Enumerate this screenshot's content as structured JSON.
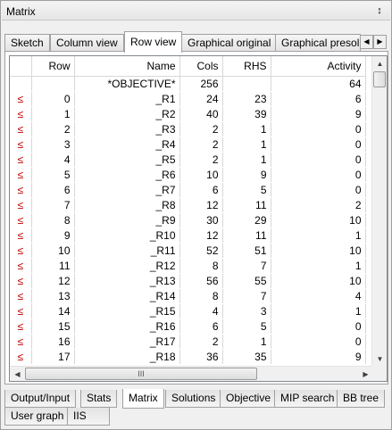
{
  "window": {
    "title": "Matrix",
    "pin_glyph": "↕"
  },
  "top_tabs": [
    "Sketch",
    "Column view",
    "Row view",
    "Graphical original",
    "Graphical presol"
  ],
  "active_top_tab": "Row view",
  "columns": [
    "",
    "Row",
    "Name",
    "Cols",
    "RHS",
    "Activity"
  ],
  "objective_row": {
    "name": "*OBJECTIVE*",
    "cols": "256",
    "rhs": "",
    "activity": "64"
  },
  "constraint_marker": "≤",
  "rows": [
    {
      "row": "0",
      "name": "_R1",
      "cols": "24",
      "rhs": "23",
      "activity": "6"
    },
    {
      "row": "1",
      "name": "_R2",
      "cols": "40",
      "rhs": "39",
      "activity": "9"
    },
    {
      "row": "2",
      "name": "_R3",
      "cols": "2",
      "rhs": "1",
      "activity": "0"
    },
    {
      "row": "3",
      "name": "_R4",
      "cols": "2",
      "rhs": "1",
      "activity": "0"
    },
    {
      "row": "4",
      "name": "_R5",
      "cols": "2",
      "rhs": "1",
      "activity": "0"
    },
    {
      "row": "5",
      "name": "_R6",
      "cols": "10",
      "rhs": "9",
      "activity": "0"
    },
    {
      "row": "6",
      "name": "_R7",
      "cols": "6",
      "rhs": "5",
      "activity": "0"
    },
    {
      "row": "7",
      "name": "_R8",
      "cols": "12",
      "rhs": "11",
      "activity": "2"
    },
    {
      "row": "8",
      "name": "_R9",
      "cols": "30",
      "rhs": "29",
      "activity": "10"
    },
    {
      "row": "9",
      "name": "_R10",
      "cols": "12",
      "rhs": "11",
      "activity": "1"
    },
    {
      "row": "10",
      "name": "_R11",
      "cols": "52",
      "rhs": "51",
      "activity": "10"
    },
    {
      "row": "11",
      "name": "_R12",
      "cols": "8",
      "rhs": "7",
      "activity": "1"
    },
    {
      "row": "12",
      "name": "_R13",
      "cols": "56",
      "rhs": "55",
      "activity": "10"
    },
    {
      "row": "13",
      "name": "_R14",
      "cols": "8",
      "rhs": "7",
      "activity": "4"
    },
    {
      "row": "14",
      "name": "_R15",
      "cols": "4",
      "rhs": "3",
      "activity": "1"
    },
    {
      "row": "15",
      "name": "_R16",
      "cols": "6",
      "rhs": "5",
      "activity": "0"
    },
    {
      "row": "16",
      "name": "_R17",
      "cols": "2",
      "rhs": "1",
      "activity": "0"
    },
    {
      "row": "17",
      "name": "_R18",
      "cols": "36",
      "rhs": "35",
      "activity": "9"
    }
  ],
  "scrollbar": {
    "up": "▲",
    "down": "▼",
    "left": "◀",
    "right": "▶",
    "grip": "III"
  },
  "tab_scroll": {
    "left": "◀",
    "right": "▶"
  },
  "bottom_tabs_row1": [
    "Output/Input",
    "Stats",
    "Matrix",
    "Solutions",
    "Objective",
    "MIP search",
    "BB tree"
  ],
  "bottom_tabs_row2": [
    "User graph",
    "IIS"
  ],
  "active_bottom_tab": "Matrix",
  "colors": {
    "marker": "#c00000",
    "border": "#a0a0a0"
  }
}
